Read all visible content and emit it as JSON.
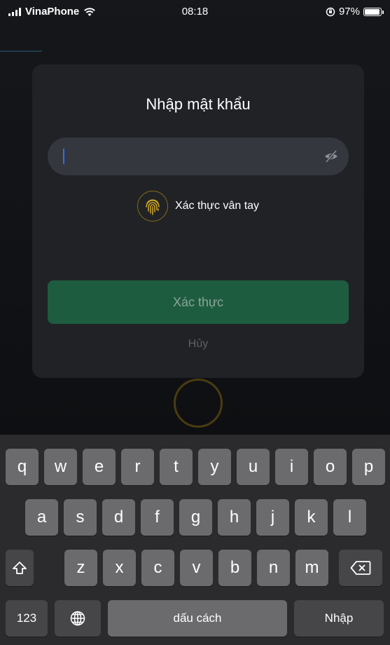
{
  "status_bar": {
    "carrier": "VinaPhone",
    "time": "08:18",
    "battery": "97%",
    "battery_level": 0.97
  },
  "dialog": {
    "title": "Nhập mật khẩu",
    "password_value": "",
    "fingerprint_label": "Xác thực vân tay",
    "confirm_label": "Xác thực",
    "cancel_label": "Hủy"
  },
  "keyboard": {
    "row1": [
      "q",
      "w",
      "e",
      "r",
      "t",
      "y",
      "u",
      "i",
      "o",
      "p"
    ],
    "row2": [
      "a",
      "s",
      "d",
      "f",
      "g",
      "h",
      "j",
      "k",
      "l"
    ],
    "row3": [
      "z",
      "x",
      "c",
      "v",
      "b",
      "n",
      "m"
    ],
    "numbers_label": "123",
    "space_label": "dấu cách",
    "return_label": "Nhập",
    "shift_icon": "shift-icon",
    "delete_icon": "backspace-icon",
    "globe_icon": "globe-icon"
  },
  "colors": {
    "confirm_bg": "#1e5c40",
    "fingerprint_accent": "#c9a227",
    "caret": "#2f6bff"
  }
}
